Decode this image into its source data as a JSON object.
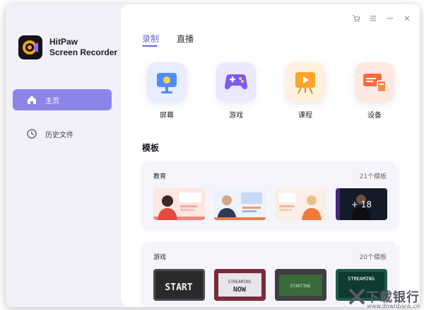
{
  "app": {
    "brand_line1": "HitPaw",
    "brand_line2": "Screen Recorder"
  },
  "window_controls": [
    "cart-icon",
    "menu-icon",
    "minimize-icon",
    "close-icon"
  ],
  "sidebar": {
    "items": [
      {
        "label": "主页",
        "icon": "home-icon",
        "active": true
      },
      {
        "label": "历史文件",
        "icon": "clock-icon",
        "active": false
      }
    ]
  },
  "tabs": [
    {
      "label": "录制",
      "active": true
    },
    {
      "label": "直播",
      "active": false
    }
  ],
  "modes": [
    {
      "label": "屏幕",
      "icon": "monitor-icon",
      "color": "#e7edff"
    },
    {
      "label": "游戏",
      "icon": "gamepad-icon",
      "color": "#ece8ff"
    },
    {
      "label": "课程",
      "icon": "presentation-icon",
      "color": "#fff1de"
    },
    {
      "label": "设备",
      "icon": "device-icon",
      "color": "#ffe8e2"
    }
  ],
  "templates": {
    "title": "模板",
    "categories": [
      {
        "name": "教育",
        "count": "21个模板",
        "more": "+ 18"
      },
      {
        "name": "游戏",
        "count": "20个模板"
      }
    ],
    "game_thumbs": [
      "START",
      "STREAMING NOW",
      "STARTING",
      "STREAMING"
    ]
  },
  "watermark": {
    "text": "下载银行",
    "url": "www.downbank.cn"
  },
  "colors": {
    "accent": "#6a63db",
    "sidebar_active": "#8b85e8"
  }
}
